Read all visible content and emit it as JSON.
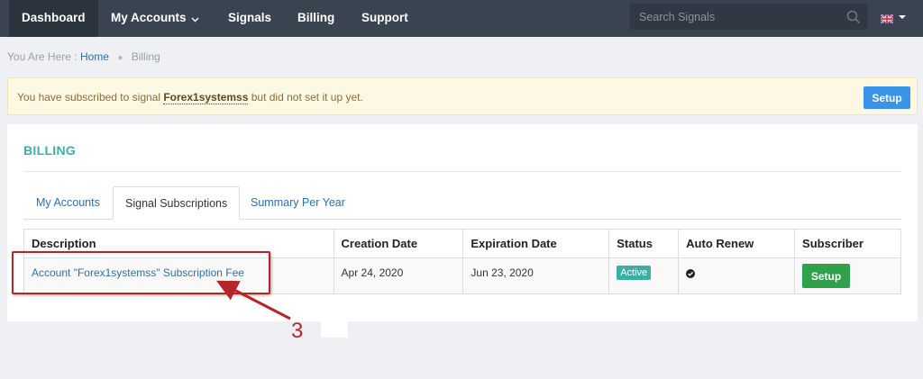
{
  "nav": {
    "items": [
      {
        "label": "Dashboard",
        "active": true
      },
      {
        "label": "My Accounts",
        "has_dropdown": true
      },
      {
        "label": "Signals"
      },
      {
        "label": "Billing"
      },
      {
        "label": "Support"
      }
    ],
    "search_placeholder": "Search Signals",
    "search_icon": "search-icon",
    "language_flag": "uk-flag-icon"
  },
  "breadcrumb": {
    "prefix": "You Are Here :",
    "home": "Home",
    "current": "Billing"
  },
  "alert": {
    "text_before": "You have subscribed to signal ",
    "signal_name": "Forex1systemss",
    "text_after": " but did not set it up yet.",
    "button": "Setup"
  },
  "billing": {
    "title": "BILLING",
    "tabs": [
      {
        "label": "My Accounts"
      },
      {
        "label": "Signal Subscriptions",
        "active": true
      },
      {
        "label": "Summary Per Year"
      }
    ],
    "columns": [
      "Description",
      "Creation Date",
      "Expiration Date",
      "Status",
      "Auto Renew",
      "Subscriber"
    ],
    "rows": [
      {
        "description": "Account \"Forex1systemss\" Subscription Fee",
        "creation_date": "Apr 24, 2020",
        "expiration_date": "Jun 23, 2020",
        "status": "Active",
        "auto_renew": "check-circle-icon",
        "subscriber_button": "Setup"
      }
    ]
  },
  "annotation": {
    "number": "3"
  },
  "colors": {
    "navbar": "#3a4450",
    "accent_teal": "#3dafa0",
    "link_blue": "#2d6fa8",
    "setup_blue": "#3a93e6",
    "setup_green": "#2da24a",
    "alert_bg": "#fcf8e3",
    "annotation_red": "#b52529"
  }
}
